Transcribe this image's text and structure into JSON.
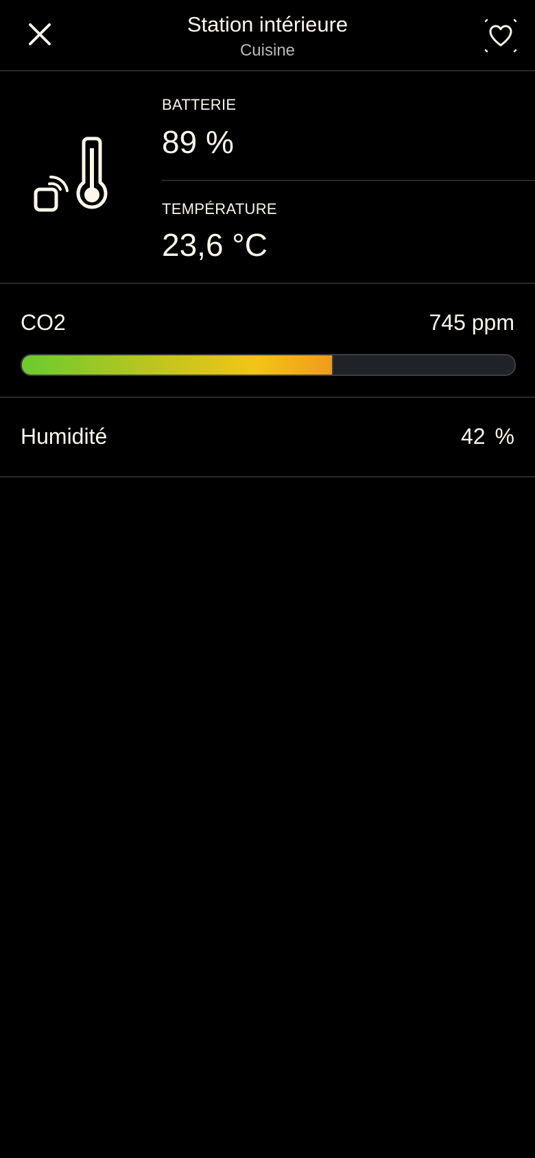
{
  "header": {
    "title": "Station intérieure",
    "subtitle": "Cuisine",
    "close_icon": "close-icon",
    "favorite_icon": "heart-icon"
  },
  "device": {
    "icon": "thermometer-wireless-icon",
    "battery_label": "BATTERIE",
    "battery_value": "89 %",
    "temperature_label": "TEMPÉRATURE",
    "temperature_value": "23,6 °C"
  },
  "co2": {
    "label": "CO2",
    "value": "745 ppm",
    "gauge_level": 0.63,
    "gauge_colors": [
      "#6acb2f",
      "#f2c515",
      "#f19a1e"
    ]
  },
  "humidity": {
    "label": "Humidité",
    "value": "42",
    "unit": "%"
  },
  "colors": {
    "background": "#000000",
    "text": "#fdf6ea",
    "muted": "#b9b9b9",
    "divider": "#2a2a2a",
    "gauge_track": "#1f2327"
  }
}
